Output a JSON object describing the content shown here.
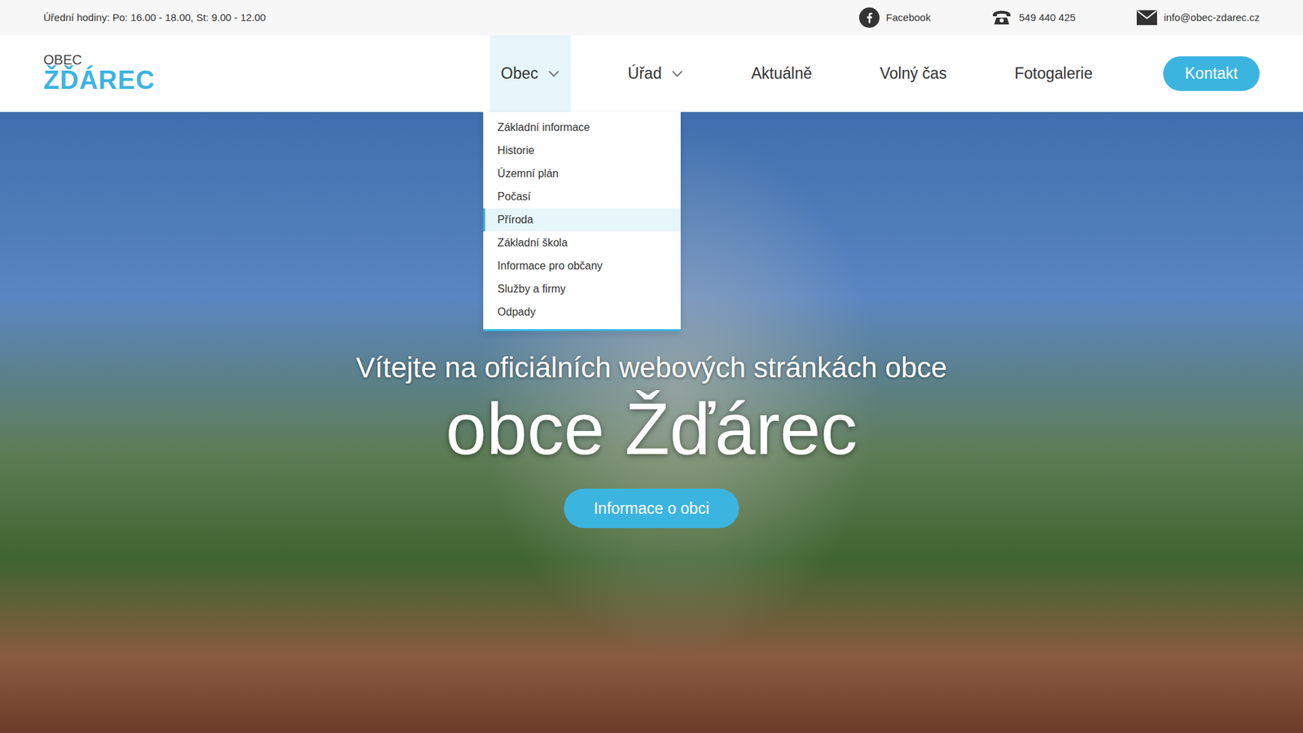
{
  "topbar": {
    "hours": "Úřední hodiny: Po:  16.00 - 18.00, St: 9.00 - 12.00",
    "facebook": "Facebook",
    "phone": "549 440 425",
    "email": "info@obec-zdarec.cz"
  },
  "logo": {
    "small": "OBEC",
    "big": "ŽĎÁREC"
  },
  "nav": [
    {
      "label": "Obec",
      "dropdown": true,
      "expanded": true
    },
    {
      "label": "Úřad",
      "dropdown": true,
      "expanded": false
    },
    {
      "label": "Aktuálně",
      "dropdown": false,
      "expanded": false
    },
    {
      "label": "Volný čas",
      "dropdown": false,
      "expanded": false
    },
    {
      "label": "Fotogalerie",
      "dropdown": false,
      "expanded": false
    }
  ],
  "contact_button": "Kontakt",
  "dropdown": [
    {
      "label": "Základní informace",
      "selected": false
    },
    {
      "label": "Historie",
      "selected": false
    },
    {
      "label": "Územní plán",
      "selected": false
    },
    {
      "label": "Počasí",
      "selected": false
    },
    {
      "label": "Příroda",
      "selected": true
    },
    {
      "label": "Základní škola",
      "selected": false
    },
    {
      "label": "Informace pro občany",
      "selected": false
    },
    {
      "label": "Služby a firmy",
      "selected": false
    },
    {
      "label": "Odpady",
      "selected": false
    }
  ],
  "hero": {
    "subtitle": "Vítejte na oficiálních webových stránkách obce",
    "title": "obce Žďárec",
    "button": "Informace o obci"
  }
}
